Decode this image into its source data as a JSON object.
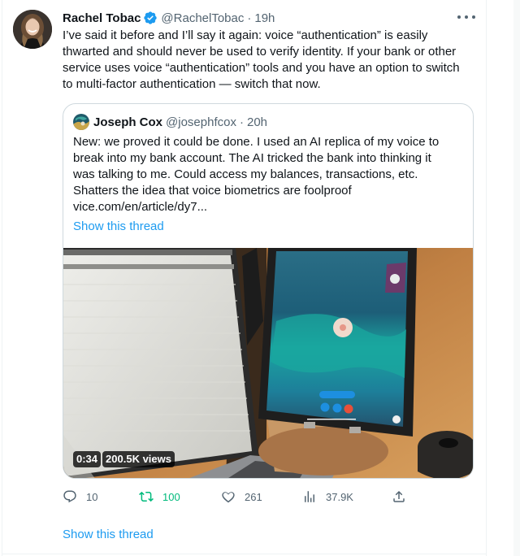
{
  "tweet": {
    "author": {
      "display_name": "Rachel Tobac",
      "handle": "@RachelTobac",
      "verified": true,
      "avatar_icon": "profile-photo"
    },
    "separator": "·",
    "time": "19h",
    "text": "I’ve said it before and I’ll say it again: voice “authentication” is easily thwarted and should never be used to verify identity. If your bank or other service uses voice “authentication” tools and you have an option to switch to multi-factor authentication — switch that now.",
    "more_icon": "more-horizontal-icon",
    "quote": {
      "author": {
        "display_name": "Joseph Cox",
        "handle": "@josephfcox",
        "avatar_icon": "profile-photo"
      },
      "separator": "·",
      "time": "20h",
      "text_lines": [
        "New: we proved it could be done. I used an AI replica of my voice to",
        "break into my bank account. The AI tricked the bank into thinking it",
        "was talking to me. Could access my balances, transactions, etc.",
        "Shatters the idea that voice biometrics are foolproof",
        "vice.com/en/article/dy7..."
      ],
      "show_thread": "Show this thread",
      "media": {
        "type": "video",
        "duration": "0:34",
        "views": "200.5K views"
      }
    },
    "actions": {
      "reply": {
        "icon": "reply-icon",
        "count": "10"
      },
      "retweet": {
        "icon": "retweet-icon",
        "count": "100",
        "active": true,
        "color": "#00ba7c"
      },
      "like": {
        "icon": "heart-icon",
        "count": "261"
      },
      "views": {
        "icon": "analytics-icon",
        "count": "37.9K"
      },
      "share": {
        "icon": "share-icon"
      }
    },
    "show_thread": "Show this thread"
  },
  "colors": {
    "link": "#1d9bf0",
    "text": "#0f1419",
    "secondary": "#536471",
    "border": "#cfd9de",
    "verified": "#1d9bf0"
  }
}
